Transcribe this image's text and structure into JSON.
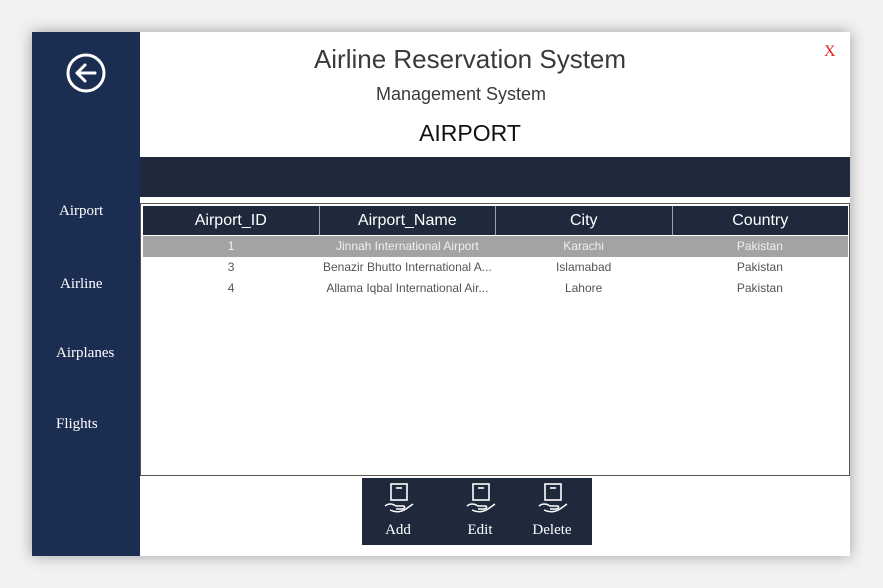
{
  "header": {
    "title": "Airline Reservation System",
    "subtitle": "Management System",
    "page_heading": "AIRPORT",
    "close_label": "X"
  },
  "sidebar": {
    "back_icon": "arrow-left-circle-icon",
    "items": [
      {
        "label": "Airport"
      },
      {
        "label": "Airline"
      },
      {
        "label": "Airplanes"
      },
      {
        "label": "Flights"
      }
    ]
  },
  "table": {
    "columns": [
      "Airport_ID",
      "Airport_Name",
      "City",
      "Country"
    ],
    "rows": [
      {
        "id": "1",
        "name": "Jinnah International Airport",
        "city": "Karachi",
        "country": "Pakistan",
        "selected": true
      },
      {
        "id": "3",
        "name": "Benazir Bhutto International A...",
        "city": "Islamabad",
        "country": "Pakistan",
        "selected": false
      },
      {
        "id": "4",
        "name": "Allama Iqbal International Air...",
        "city": "Lahore",
        "country": "Pakistan",
        "selected": false
      }
    ]
  },
  "toolbar": {
    "add_label": "Add",
    "edit_label": "Edit",
    "delete_label": "Delete",
    "icon": "box-in-hand-icon"
  },
  "colors": {
    "sidebar": "#1c2d52",
    "dark_panel": "#1e2a3c",
    "selected_row": "#a3a3a3",
    "close": "#e02020"
  }
}
